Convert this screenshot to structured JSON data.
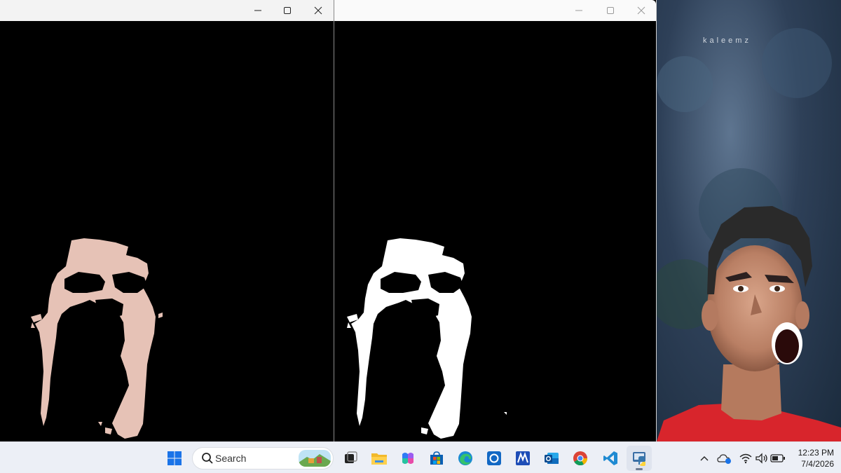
{
  "windows": [
    {
      "name": "foreground-mask-window",
      "state": "active"
    },
    {
      "name": "binary-mask-window",
      "state": "inactive"
    }
  ],
  "desktop": {
    "watermark": "kaleemz"
  },
  "taskbar": {
    "search": {
      "placeholder": "Search"
    },
    "apps": [
      "start-menu",
      "task-view",
      "file-explorer",
      "copilot",
      "microsoft-store",
      "edge",
      "cortana",
      "app-m",
      "outlook",
      "chrome",
      "vscode",
      "python"
    ],
    "tray": [
      "show-hidden-icons",
      "onedrive",
      "wifi",
      "volume",
      "battery"
    ],
    "clock": {
      "time": "12:23 PM",
      "date": "7/4/2026"
    }
  },
  "colors": {
    "taskbar_bg": "#eceff6",
    "titlebar_bg": "#f3f3f3",
    "skin": "#e6c2b6",
    "mask_white": "#ffffff",
    "jersey_red": "#d8252c"
  }
}
